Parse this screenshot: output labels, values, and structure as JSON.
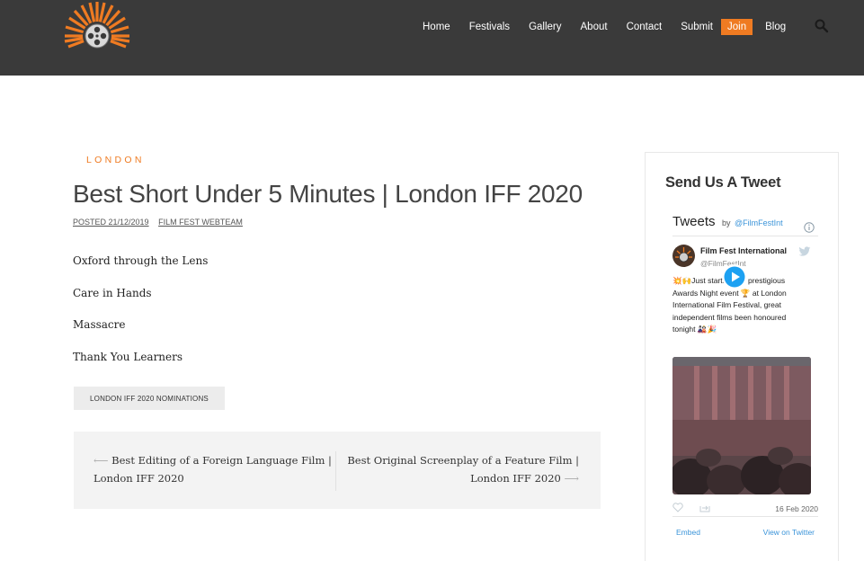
{
  "nav": {
    "items": [
      "Home",
      "Festivals",
      "Gallery",
      "About",
      "Contact",
      "Submit",
      "Join",
      "Blog"
    ],
    "search_icon": "search-icon",
    "accent": "#ef7b22"
  },
  "post": {
    "category": "LONDON",
    "title": "Best Short Under 5 Minutes | London IFF 2020",
    "posted": "POSTED 21/12/2019",
    "author": "FILM FEST WEBTEAM",
    "items": [
      "Oxford through the Lens",
      "Care in Hands",
      "Massacre",
      "Thank You Learners"
    ],
    "tag": "LONDON IFF 2020 NOMINATIONS"
  },
  "postnav": {
    "prev": "Best Editing of a Foreign Language Film | London IFF 2020",
    "next": "Best Original Screenplay of a Feature Film | London IFF 2020",
    "prev_arrow": "⟵",
    "next_arrow": "⟶"
  },
  "sidebar": {
    "title": "Send Us A Tweet",
    "tweets_label": "Tweets",
    "by_label": "by",
    "handle": "@FilmFestInt",
    "tweet": {
      "name": "Film Fest International",
      "user": "@FilmFestInt",
      "text": "💥🙌Just starting our prestigious Awards Night event 🏆 at London International Film Festival, great independent films been honoured tonight 🎎🎉",
      "date": "16 Feb 2020",
      "embed": "Embed",
      "view": "View on Twitter"
    }
  }
}
